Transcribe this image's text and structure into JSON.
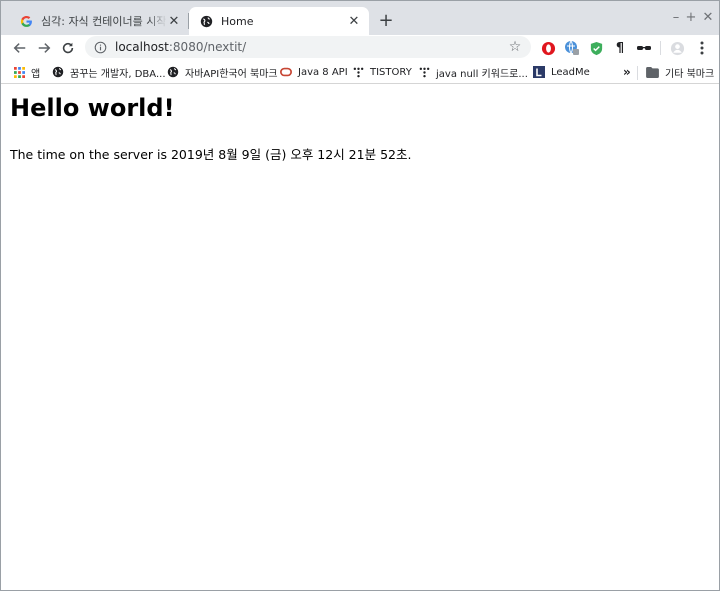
{
  "tabs": [
    {
      "title": "심각: 자식 컨테이너를 시작 중 실패",
      "active": false,
      "favicon": "google-g-icon"
    },
    {
      "title": "Home",
      "active": true,
      "favicon": "globe-icon"
    }
  ],
  "toolbar": {
    "url_host": "localhost",
    "url_rest": ":8080/nextit/",
    "extensions": [
      "opera-red-o-icon",
      "globe-extension-icon",
      "shield-check-icon",
      "pilcrow-icon",
      "glasses-incognito-icon",
      "profile-icon",
      "menu-dots-icon"
    ]
  },
  "bookmarks": {
    "apps_label": "앱",
    "items": [
      {
        "label": "꿈꾸는 개발자, DBA...",
        "icon": "globe-icon"
      },
      {
        "label": "자바API한국어 북마크",
        "icon": "globe-icon"
      },
      {
        "label": "Java 8 API",
        "icon": "oracle-icon"
      },
      {
        "label": "TISTORY",
        "icon": "tistory-icon"
      },
      {
        "label": "java null 키워드로...",
        "icon": "tistory-icon"
      },
      {
        "label": "LeadMe",
        "icon": "leadme-l-icon"
      }
    ],
    "overflow_label": "»",
    "other_label": "기타 북마크"
  },
  "page": {
    "heading": "Hello world!",
    "time_text": "The time on the server is 2019년 8월 9일 (금) 오후 12시 21분 52초."
  },
  "colors": {
    "tabstrip": "#dee1e6",
    "omnibox": "#f1f3f4",
    "google_blue": "#4285f4",
    "opera_red": "#e0161e",
    "oracle_red": "#c74634",
    "leadme_navy": "#2b3a67"
  }
}
